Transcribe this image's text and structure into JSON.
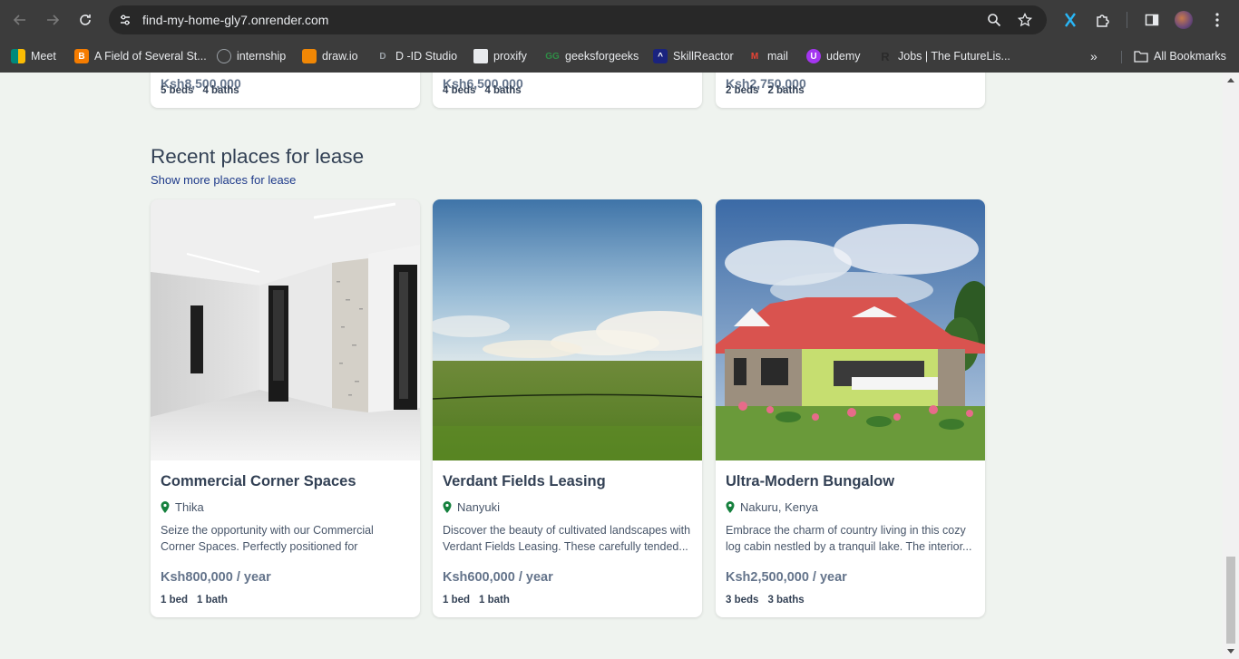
{
  "browser": {
    "url": "find-my-home-gly7.onrender.com",
    "bookmarks": [
      {
        "label": "Meet",
        "icon": "meet-icon",
        "color": "#00897b"
      },
      {
        "label": "A Field of Several St...",
        "icon": "blogger-icon",
        "color": "#f57c00"
      },
      {
        "label": "internship",
        "icon": "globe-icon",
        "color": "#9aa0a6"
      },
      {
        "label": "draw.io",
        "icon": "drawio-icon",
        "color": "#f08705"
      },
      {
        "label": "D -ID Studio",
        "icon": "did-icon",
        "color": "#5f6368"
      },
      {
        "label": "proxify",
        "icon": "proxify-icon",
        "color": "#ffffff"
      },
      {
        "label": "geeksforgeeks",
        "icon": "gfg-icon",
        "color": "#2f8d46"
      },
      {
        "label": "SkillReactor",
        "icon": "skillreactor-icon",
        "color": "#1a237e"
      },
      {
        "label": "mail",
        "icon": "gmail-icon",
        "color": "#ea4335"
      },
      {
        "label": "udemy",
        "icon": "udemy-icon",
        "color": "#a435f0"
      },
      {
        "label": "Jobs | The FutureLis...",
        "icon": "futurelist-icon",
        "color": "#3c3c3c"
      }
    ],
    "all_bookmarks": "All Bookmarks"
  },
  "top_cards": [
    {
      "price": "Ksh8,500,000",
      "beds": "5 beds",
      "baths": "4 baths"
    },
    {
      "price": "Ksh6,500,000",
      "beds": "4 beds",
      "baths": "4 baths"
    },
    {
      "price": "Ksh2,750,000",
      "beds": "2 beds",
      "baths": "2 baths"
    }
  ],
  "section": {
    "title": "Recent places for lease",
    "link": "Show more places for lease"
  },
  "listings": [
    {
      "title": "Commercial Corner Spaces",
      "location": "Thika",
      "description": "Seize the opportunity with our Commercial Corner Spaces. Perfectly positioned for business...",
      "price": "Ksh800,000 / year",
      "beds": "1 bed",
      "baths": "1 bath"
    },
    {
      "title": "Verdant Fields Leasing",
      "location": "Nanyuki",
      "description": "Discover the beauty of cultivated landscapes with Verdant Fields Leasing. These carefully tended...",
      "price": "Ksh600,000 / year",
      "beds": "1 bed",
      "baths": "1 bath"
    },
    {
      "title": "Ultra-Modern Bungalow",
      "location": "Nakuru, Kenya",
      "description": "Embrace the charm of country living in this cozy log cabin nestled by a tranquil lake. The interior...",
      "price": "Ksh2,500,000 / year",
      "beds": "3 beds",
      "baths": "3 baths"
    }
  ],
  "colors": {
    "page_bg": "#eff3ef",
    "pin": "#15803d",
    "link": "#1e3a8a"
  }
}
